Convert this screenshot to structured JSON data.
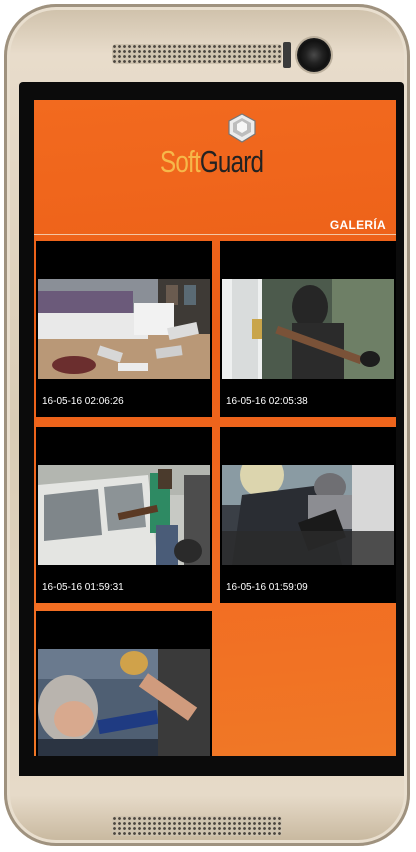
{
  "app": {
    "brand_soft": "Soft",
    "brand_guard": "Guard"
  },
  "header": {
    "section_title": "GALERÍA"
  },
  "gallery": {
    "items": [
      {
        "timestamp": "16-05-16 02:06:26",
        "scene": "messy-room"
      },
      {
        "timestamp": "16-05-16 02:05:38",
        "scene": "door-intruder"
      },
      {
        "timestamp": "16-05-16 01:59:31",
        "scene": "car-window"
      },
      {
        "timestamp": "16-05-16 01:59:09",
        "scene": "car-seat"
      },
      {
        "timestamp": "",
        "scene": "assault"
      }
    ]
  },
  "colors": {
    "accent": "#f26a1f",
    "brand_gold": "#f6b84a",
    "brand_dark": "#222222"
  }
}
